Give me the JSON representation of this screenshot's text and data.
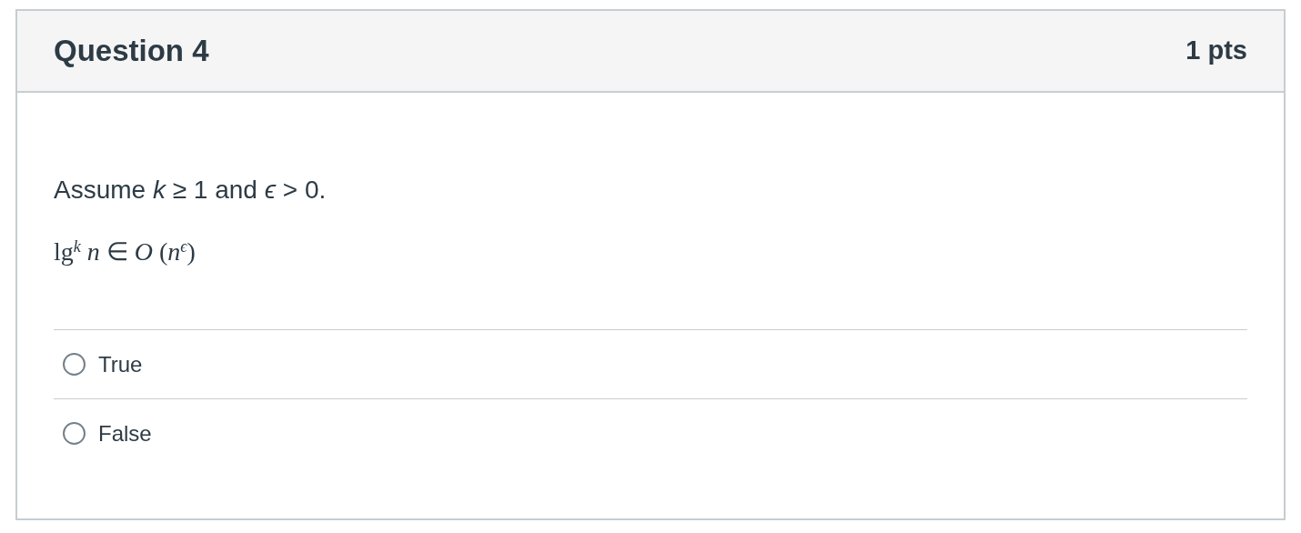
{
  "question": {
    "title": "Question 4",
    "points": "1 pts"
  },
  "prompt": [
    "Assume *k* ≥ 1 and *ϵ* > 0.",
    "lg$^{k}$ *n* ∈ *O* (*n*$^{ϵ}$)"
  ],
  "answers": [
    {
      "label": "True",
      "selected": false
    },
    {
      "label": "False",
      "selected": false
    }
  ]
}
